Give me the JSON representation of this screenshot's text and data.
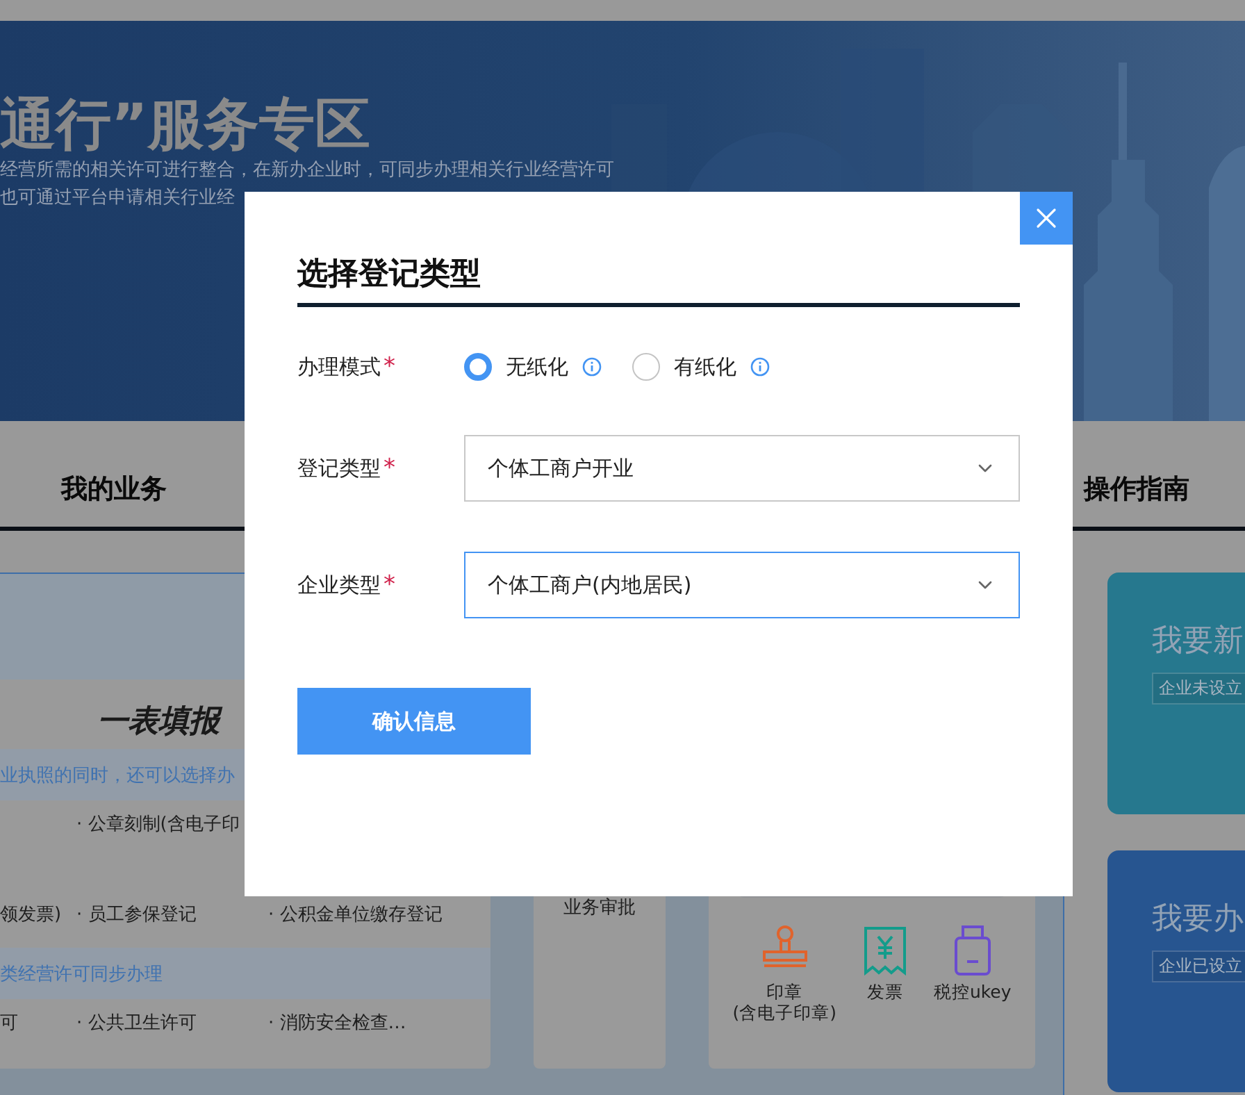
{
  "hero": {
    "title": "通行”服务专区",
    "lines": [
      "经营所需的相关许可进行整合，在新办企业时，可同步办理相关行业经营许可",
      "也可通过平台申请相关行业经"
    ]
  },
  "tabs": [
    {
      "label": "我的业务"
    },
    {
      "label": "操作指南"
    }
  ],
  "form_card": {
    "title": "一表填报",
    "groups": [
      {
        "note": "业执照的同时，还可以选择办",
        "rows": [
          [
            null,
            "· 公章刻制(含电子印"
          ],
          [
            "领发票)",
            "· 员工参保登记",
            "· 公积金单位缴存登记"
          ]
        ]
      },
      {
        "note": "类经营许可同步办理",
        "rows": [
          [
            "可",
            "· 公共卫生许可",
            "· 消防安全检查…"
          ]
        ]
      }
    ]
  },
  "approval": {
    "label": "业务审批"
  },
  "materials": [
    {
      "kind": "stamp",
      "label": "印章",
      "sub": "(含电子印章)"
    },
    {
      "kind": "invoice",
      "label": "发票"
    },
    {
      "kind": "usb",
      "label": "税控ukey"
    }
  ],
  "entry_cards": [
    {
      "title": "我要新",
      "tag": "企业未设立",
      "color": "#26788e"
    },
    {
      "title": "我要办",
      "tag": "企业已设立",
      "color": "#275590"
    }
  ],
  "dialog": {
    "title": "选择登记类型",
    "fields": [
      {
        "kind": "radio",
        "label": "办理模式",
        "mark": "*",
        "options": [
          {
            "label": "无纸化",
            "selected": true
          },
          {
            "label": "有纸化",
            "selected": false
          }
        ]
      },
      {
        "kind": "select",
        "label": "登记类型",
        "mark": "*",
        "value": "个体工商户开业",
        "focused": false
      },
      {
        "kind": "select",
        "label": "企业类型",
        "mark": "*",
        "value": "个体工商户(内地居民)",
        "focused": true
      }
    ],
    "submit": "确认信息"
  }
}
